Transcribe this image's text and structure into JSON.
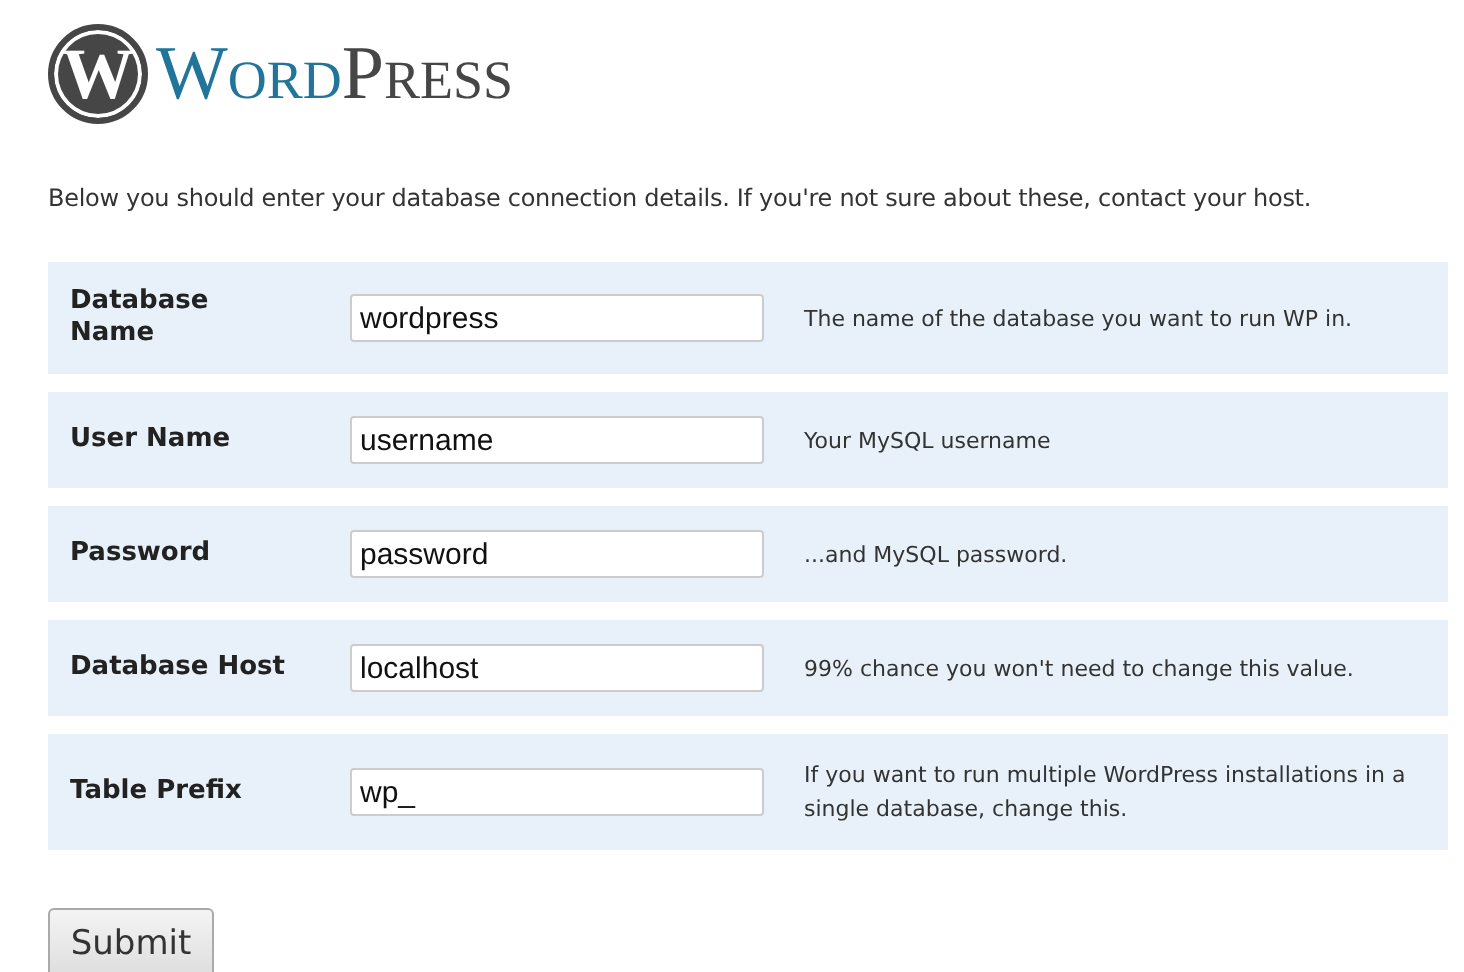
{
  "logo": {
    "mark": "W",
    "wordmark": [
      {
        "text": "Word",
        "color": "#21759b"
      },
      {
        "text": "Press",
        "color": "#464646"
      }
    ]
  },
  "intro": "Below you should enter your database connection details. If you're not sure about these, contact your host.",
  "fields": [
    {
      "label": "Database Name",
      "value": "wordpress",
      "help": "The name of the database you want to run WP in."
    },
    {
      "label": "User Name",
      "value": "username",
      "help": "Your MySQL username"
    },
    {
      "label": "Password",
      "value": "password",
      "help": "...and MySQL password."
    },
    {
      "label": "Database Host",
      "value": "localhost",
      "help": "99% chance you won't need to change this value."
    },
    {
      "label": "Table Prefix",
      "value": "wp_",
      "help": "If you want to run multiple WordPress installations in a single database, change this."
    }
  ],
  "submit": "Submit"
}
